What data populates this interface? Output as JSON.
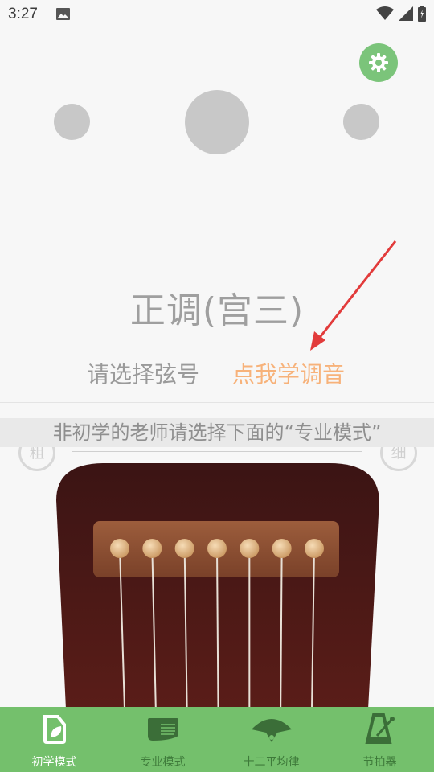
{
  "status_bar": {
    "time": "3:27",
    "icons": [
      "image-icon",
      "wifi-icon",
      "signal-icon",
      "battery-icon"
    ]
  },
  "header": {
    "settings_icon": "gear-icon",
    "accent_color": "#7bc47a"
  },
  "tuning": {
    "title": "正调(宫三)",
    "select_string": "请选择弦号",
    "learn_tuning": "点我学调音",
    "learn_color": "#f7b27a"
  },
  "hint": {
    "text": "非初学的老师请选择下面的“专业模式”",
    "left_button": "粗",
    "right_button": "细"
  },
  "instrument": {
    "string_count": 7
  },
  "bottom_nav": {
    "background": "#74c06c",
    "items": [
      {
        "label": "初学模式",
        "icon": "beginner-leaf-icon",
        "active": true
      },
      {
        "label": "专业模式",
        "icon": "pro-mode-icon",
        "active": false
      },
      {
        "label": "十二平均律",
        "icon": "fan-icon",
        "active": false
      },
      {
        "label": "节拍器",
        "icon": "metronome-icon",
        "active": false
      }
    ]
  }
}
